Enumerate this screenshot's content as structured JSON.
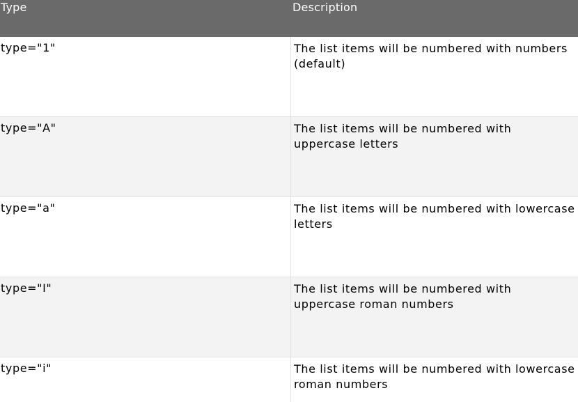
{
  "table": {
    "headers": {
      "type": "Type",
      "description": "Description"
    },
    "rows": [
      {
        "type": "type=\"1\"",
        "description_lines": [
          "The list items will be numbered with numbers",
          "(default)"
        ]
      },
      {
        "type": "type=\"A\"",
        "description_lines": [
          "The list items will be numbered with",
          "uppercase letters"
        ]
      },
      {
        "type": "type=\"a\"",
        "description_lines": [
          "The list items will be numbered with lowercase",
          "letters"
        ]
      },
      {
        "type": "type=\"I\"",
        "description_lines": [
          "The list items will be numbered with",
          "uppercase roman numbers"
        ]
      },
      {
        "type": "type=\"i\"",
        "description_lines": [
          "The list items will be numbered with lowercase",
          "roman numbers"
        ]
      }
    ]
  },
  "colors": {
    "header_bg": "#6a6a6a",
    "alt_row_bg": "#f3f3f3",
    "row_bg": "#ffffff"
  }
}
